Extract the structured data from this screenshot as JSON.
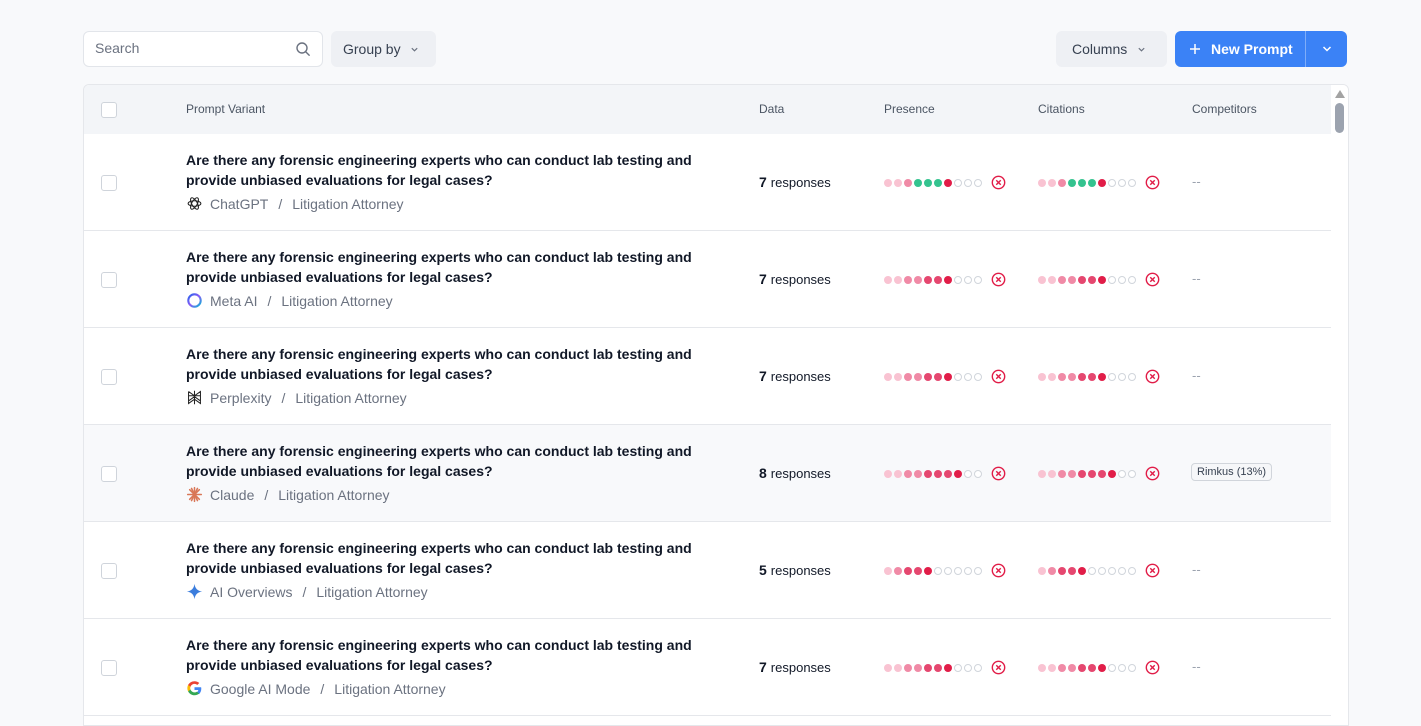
{
  "toolbar": {
    "search_placeholder": "Search",
    "group_by_label": "Group by",
    "columns_label": "Columns",
    "new_prompt_label": "New Prompt"
  },
  "table": {
    "headers": [
      "Prompt Variant",
      "Data",
      "Presence",
      "Citations",
      "Competitors"
    ],
    "rows": [
      {
        "question": "Are there any forensic engineering experts who can conduct lab testing and provide unbiased evaluations for legal cases?",
        "engine": "ChatGPT",
        "engine_icon": "chatgpt-icon",
        "persona": "Litigation Attorney",
        "count": "7",
        "count_unit": "responses",
        "presence": [
          "light",
          "light",
          "mid",
          "green",
          "green",
          "green",
          "red",
          "empty",
          "empty",
          "empty"
        ],
        "citations": [
          "light",
          "light",
          "mid",
          "green",
          "green",
          "green",
          "red",
          "empty",
          "empty",
          "empty"
        ],
        "competitors": "--",
        "highlighted": false
      },
      {
        "question": "Are there any forensic engineering experts who can conduct lab testing and provide unbiased evaluations for legal cases?",
        "engine": "Meta AI",
        "engine_icon": "meta-ai-icon",
        "persona": "Litigation Attorney",
        "count": "7",
        "count_unit": "responses",
        "presence": [
          "light",
          "light",
          "mid",
          "mid",
          "strong",
          "strong",
          "red",
          "empty",
          "empty",
          "empty"
        ],
        "citations": [
          "light",
          "light",
          "mid",
          "mid",
          "strong",
          "strong",
          "red",
          "empty",
          "empty",
          "empty"
        ],
        "competitors": "--",
        "highlighted": false
      },
      {
        "question": "Are there any forensic engineering experts who can conduct lab testing and provide unbiased evaluations for legal cases?",
        "engine": "Perplexity",
        "engine_icon": "perplexity-icon",
        "persona": "Litigation Attorney",
        "count": "7",
        "count_unit": "responses",
        "presence": [
          "light",
          "light",
          "mid",
          "mid",
          "strong",
          "strong",
          "red",
          "empty",
          "empty",
          "empty"
        ],
        "citations": [
          "light",
          "light",
          "mid",
          "mid",
          "strong",
          "strong",
          "red",
          "empty",
          "empty",
          "empty"
        ],
        "competitors": "--",
        "highlighted": false
      },
      {
        "question": "Are there any forensic engineering experts who can conduct lab testing and provide unbiased evaluations for legal cases?",
        "engine": "Claude",
        "engine_icon": "claude-icon",
        "persona": "Litigation Attorney",
        "count": "8",
        "count_unit": "responses",
        "presence": [
          "light",
          "light",
          "mid",
          "mid",
          "strong",
          "strong",
          "strong",
          "red",
          "empty",
          "empty"
        ],
        "citations": [
          "light",
          "light",
          "mid",
          "mid",
          "strong",
          "strong",
          "strong",
          "red",
          "empty",
          "empty"
        ],
        "competitors": "Rimkus (13%)",
        "highlighted": true
      },
      {
        "question": "Are there any forensic engineering experts who can conduct lab testing and provide unbiased evaluations for legal cases?",
        "engine": "AI Overviews",
        "engine_icon": "ai-overviews-icon",
        "persona": "Litigation Attorney",
        "count": "5",
        "count_unit": "responses",
        "presence": [
          "light",
          "mid",
          "strong",
          "strong",
          "red",
          "empty",
          "empty",
          "empty",
          "empty",
          "empty"
        ],
        "citations": [
          "light",
          "mid",
          "strong",
          "strong",
          "red",
          "empty",
          "empty",
          "empty",
          "empty",
          "empty"
        ],
        "competitors": "--",
        "highlighted": false
      },
      {
        "question": "Are there any forensic engineering experts who can conduct lab testing and provide unbiased evaluations for legal cases?",
        "engine": "Google AI Mode",
        "engine_icon": "google-icon",
        "persona": "Litigation Attorney",
        "count": "7",
        "count_unit": "responses",
        "presence": [
          "light",
          "light",
          "mid",
          "mid",
          "strong",
          "strong",
          "red",
          "empty",
          "empty",
          "empty"
        ],
        "citations": [
          "light",
          "light",
          "mid",
          "mid",
          "strong",
          "strong",
          "red",
          "empty",
          "empty",
          "empty"
        ],
        "competitors": "--",
        "highlighted": false
      }
    ]
  },
  "colors": {
    "accent": "#3b82f6",
    "light": "#f9c3d2",
    "mid": "#f08aa6",
    "strong": "#e5476f",
    "green": "#34c38f",
    "red": "#e11d48",
    "empty": "#d1d5db"
  }
}
